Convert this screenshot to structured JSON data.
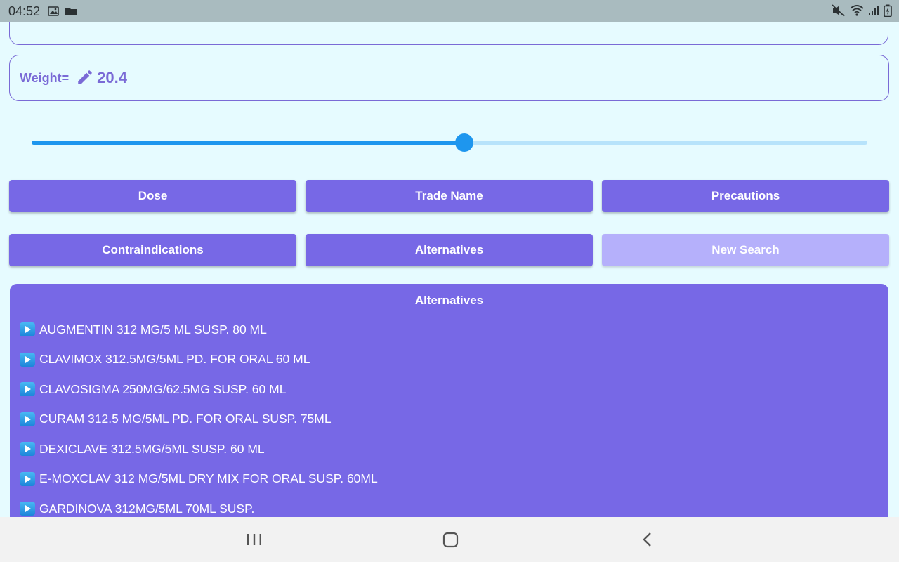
{
  "status_bar": {
    "time": "04:52",
    "icons": [
      "image-icon",
      "folder-icon",
      "mute-icon",
      "wifi-icon",
      "signal-icon",
      "battery-icon"
    ]
  },
  "weight": {
    "label": "Weight=",
    "value": "20.4"
  },
  "slider": {
    "fraction": 0.518
  },
  "buttons": {
    "dose": "Dose",
    "trade_name": "Trade Name",
    "precautions": "Precautions",
    "contraindications": "Contraindications",
    "alternatives": "Alternatives",
    "new_search": "New Search"
  },
  "alternatives_panel": {
    "title": "Alternatives",
    "items": [
      "AUGMENTIN 312 MG/5 ML SUSP. 80 ML",
      "CLAVIMOX 312.5MG/5ML PD. FOR ORAL 60 ML",
      "CLAVOSIGMA 250MG/62.5MG SUSP. 60 ML",
      "CURAM 312.5 MG/5ML PD. FOR ORAL SUSP. 75ML",
      "DEXICLAVE 312.5MG/5ML SUSP. 60 ML",
      "E-MOXCLAV 312 MG/5ML DRY MIX FOR ORAL SUSP. 60ML",
      "GARDINOVA 312MG/5ML 70ML SUSP."
    ]
  },
  "colors": {
    "accent": "#7768e6",
    "accent_disabled": "#b5b0fb",
    "slider": "#1e96ee",
    "background": "#e6fbff"
  }
}
